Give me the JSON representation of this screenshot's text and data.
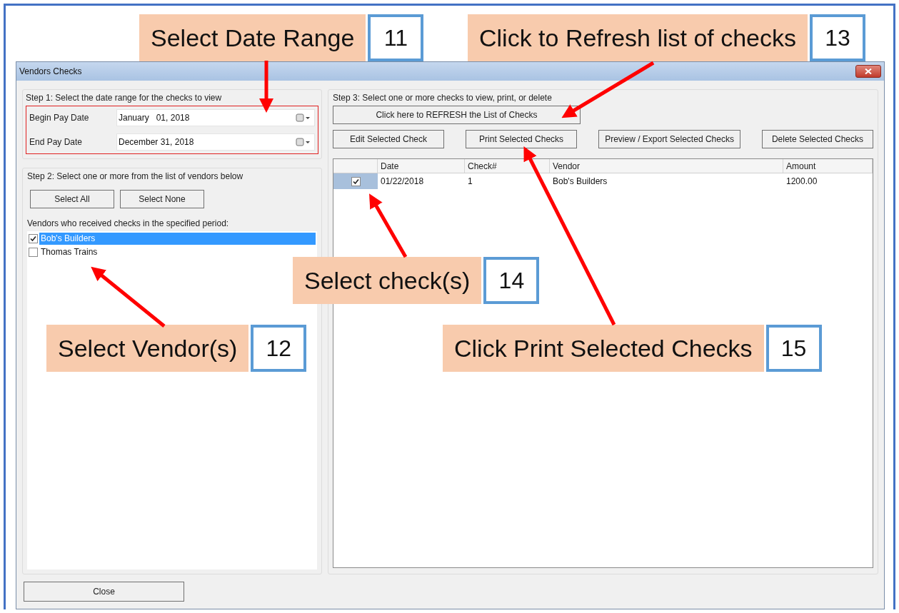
{
  "window": {
    "title": "Vendors Checks"
  },
  "step1": {
    "label": "Step 1: Select the date range for the checks to view",
    "fields": [
      {
        "label": "Begin Pay Date",
        "value": "January   01, 2018"
      },
      {
        "label": "End Pay Date",
        "value": "December 31, 2018"
      }
    ]
  },
  "step2": {
    "label": "Step 2: Select one or more from the list of vendors below",
    "buttons": [
      "Select All",
      "Select None"
    ],
    "list_label": "Vendors who received checks in the specified period:",
    "vendors": [
      {
        "name": "Bob's Builders",
        "checked": true,
        "selected": true
      },
      {
        "name": "Thomas Trains",
        "checked": false,
        "selected": false
      }
    ]
  },
  "step3": {
    "label": "Step 3: Select one or more checks to view, print, or delete",
    "refresh_button": "Click here to REFRESH the List of Checks",
    "buttons": [
      "Edit Selected Check",
      "Print Selected Checks",
      "Preview / Export Selected Checks",
      "Delete Selected Checks"
    ],
    "table": {
      "columns": [
        "Date",
        "Check#",
        "Vendor",
        "Amount"
      ],
      "rows": [
        {
          "checked": true,
          "cells": [
            "01/22/2018",
            "1",
            "Bob's Builders",
            "1200.00"
          ]
        }
      ]
    }
  },
  "close_button": "Close",
  "callouts": [
    {
      "text": "Select Date Range",
      "number": "11"
    },
    {
      "text": "Click to Refresh list of checks",
      "number": "13"
    },
    {
      "text": "Select check(s)",
      "number": "14"
    },
    {
      "text": "Select Vendor(s)",
      "number": "12"
    },
    {
      "text": "Click Print Selected Checks",
      "number": "15"
    }
  ]
}
